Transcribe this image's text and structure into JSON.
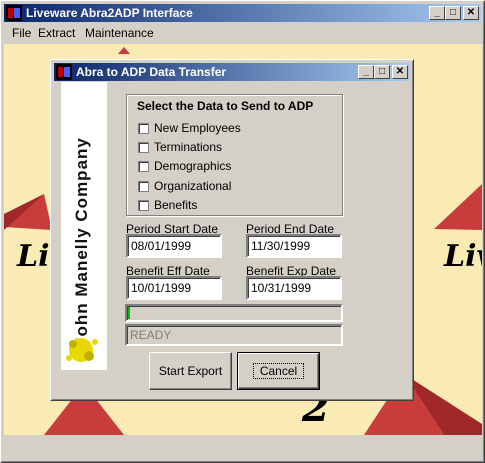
{
  "main_window": {
    "title": "Liveware Abra2ADP Interface",
    "controls": {
      "minimize": "_",
      "maximize": "□",
      "close": "✕"
    }
  },
  "menu": [
    "File",
    "Extract",
    "Maintenance"
  ],
  "background": {
    "left_text": "Liv",
    "right_text": "Liv",
    "bottom_text": "2"
  },
  "dialog": {
    "title": "Abra to ADP Data Transfer",
    "logo_text": "John Manelly Company",
    "group_title": "Select the Data to Send to ADP",
    "checkboxes": [
      {
        "label": "New Employees",
        "checked": false
      },
      {
        "label": "Terminations",
        "checked": false
      },
      {
        "label": "Demographics",
        "checked": false
      },
      {
        "label": "Organizational",
        "checked": false
      },
      {
        "label": "Benefits",
        "checked": false
      }
    ],
    "period_start": {
      "label": "Period Start Date",
      "value": "08/01/1999"
    },
    "period_end": {
      "label": "Period End Date",
      "value": "11/30/1999"
    },
    "benefit_eff": {
      "label": "Benefit Eff Date",
      "value": "10/01/1999"
    },
    "benefit_exp": {
      "label": "Benefit Exp Date",
      "value": "10/31/1999"
    },
    "progress_fraction": 0.01,
    "status": "READY",
    "buttons": {
      "start_export": "Start Export",
      "cancel": "Cancel"
    }
  },
  "colors": {
    "title_active": "#0a246a",
    "background": "#faebb4",
    "progress": "#00c000"
  }
}
